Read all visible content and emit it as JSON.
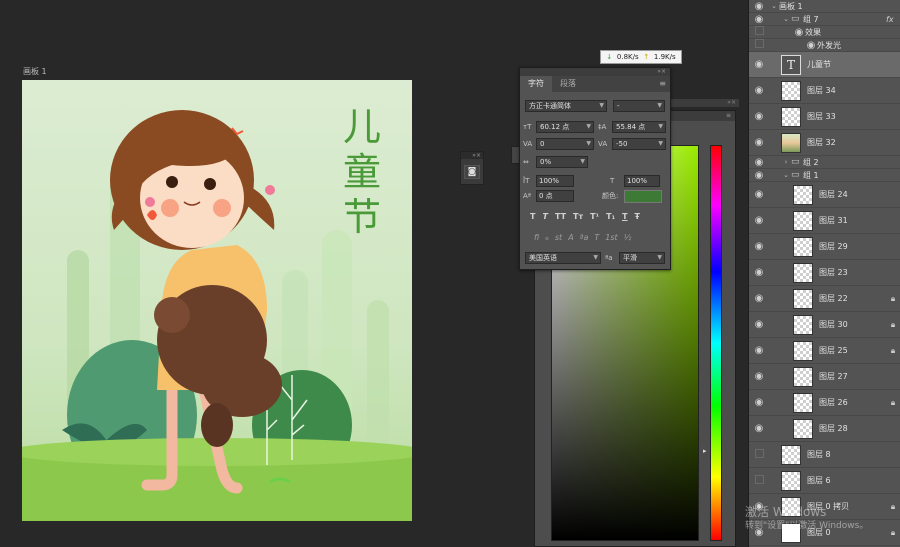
{
  "artboard": {
    "title": "画板 1",
    "illustration_title": [
      "儿",
      "童",
      "节"
    ]
  },
  "network_monitor": {
    "download": "0.8K/s",
    "upload": "1.9K/s"
  },
  "character_panel": {
    "tabs": [
      "字符",
      "段落"
    ],
    "font_family": "方正卡通简体",
    "font_style": "-",
    "font_size": "60.12 点",
    "leading": "55.84 点",
    "kerning": "0",
    "tracking": "-50",
    "tsume": "0%",
    "vertical_scale": "100%",
    "horizontal_scale": "100%",
    "baseline_shift": "0 点",
    "color_label": "颜色:",
    "color_value": "#3d7a35",
    "style_buttons": [
      "T",
      "T",
      "TT",
      "Tт",
      "T¹",
      "T₁",
      "T",
      "Ŧ"
    ],
    "opentype_buttons": [
      "fi",
      "ℴ",
      "st",
      "A",
      "ªa",
      "T",
      "1st",
      "½"
    ],
    "language": "美国英语",
    "aa_label": "ªa",
    "antialias": "平滑"
  },
  "layers_panel": {
    "rows": [
      {
        "name": "画板 1",
        "type": "artboard"
      },
      {
        "name": "组 7",
        "type": "group",
        "fx": "fx"
      },
      {
        "name": "效果",
        "type": "effect"
      },
      {
        "name": "外发光",
        "type": "effect2"
      },
      {
        "name": "儿童节",
        "type": "text",
        "selected": true
      },
      {
        "name": "图层 34",
        "type": "layer"
      },
      {
        "name": "图层 33",
        "type": "layer"
      },
      {
        "name": "图层 32",
        "type": "image"
      },
      {
        "name": "组 2",
        "type": "group-closed"
      },
      {
        "name": "组 1",
        "type": "group-open"
      },
      {
        "name": "图层 24",
        "type": "layer"
      },
      {
        "name": "图层 31",
        "type": "layer"
      },
      {
        "name": "图层 29",
        "type": "layer"
      },
      {
        "name": "图层 23",
        "type": "layer"
      },
      {
        "name": "图层 22",
        "type": "layer",
        "locked": true
      },
      {
        "name": "图层 30",
        "type": "layer",
        "locked": true
      },
      {
        "name": "图层 25",
        "type": "layer",
        "locked": true
      },
      {
        "name": "图层 27",
        "type": "layer"
      },
      {
        "name": "图层 26",
        "type": "layer",
        "locked": true
      },
      {
        "name": "图层 28",
        "type": "layer"
      },
      {
        "name": "图层 8",
        "type": "layer",
        "hidden": true
      },
      {
        "name": "图层 6",
        "type": "layer",
        "hidden": true
      },
      {
        "name": "图层 0 拷贝",
        "type": "layer",
        "locked": true
      },
      {
        "name": "图层 0",
        "type": "white",
        "locked": true
      }
    ]
  },
  "watermark": {
    "line1": "激活 Windows",
    "line2": "转到\"设置\"以激活 Windows。"
  },
  "icons": {
    "eye": "eye-icon",
    "lock": "lock-icon",
    "folder": "folder-icon",
    "hamburger": "panel-menu-icon"
  }
}
